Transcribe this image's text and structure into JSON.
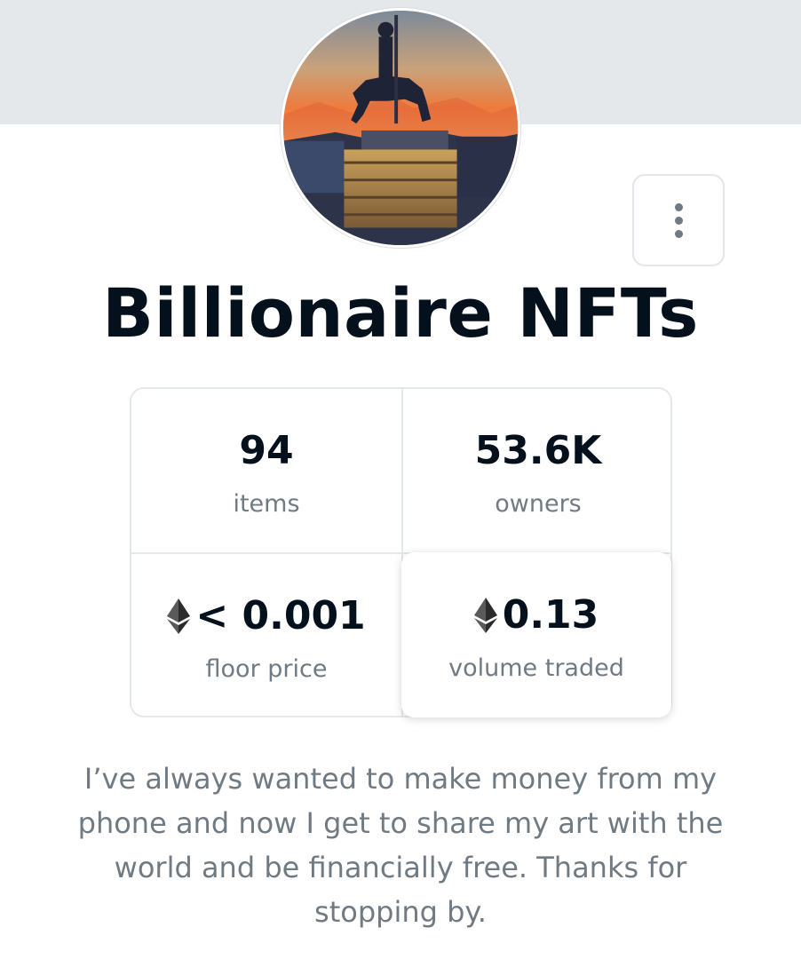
{
  "collection": {
    "name": "Billionaire NFTs",
    "avatar_description": "avatar-image",
    "more_menu_icon": "more-vertical-icon"
  },
  "stats": {
    "items": {
      "value": "94",
      "label": "items"
    },
    "owners": {
      "value": "53.6K",
      "label": "owners"
    },
    "floor_price": {
      "value": "< 0.001",
      "label": "floor price",
      "icon": "ethereum-icon"
    },
    "volume_traded": {
      "value": "0.13",
      "label": "volume traded",
      "icon": "ethereum-icon"
    }
  },
  "description": "I’ve always wanted to make money from my phone and now I get to share my art with the world and be financially free. Thanks for stopping by.",
  "colors": {
    "banner": "#e5e8eb",
    "title": "#04111d",
    "muted": "#707a83",
    "border": "#e5e8eb"
  }
}
